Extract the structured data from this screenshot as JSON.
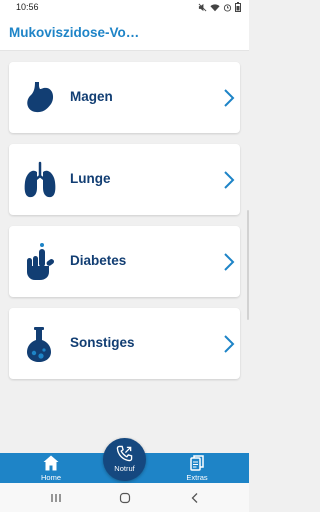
{
  "status_bar": {
    "time": "10:56"
  },
  "app_bar": {
    "title": "Mukoviszidose-Vo…"
  },
  "categories": [
    {
      "label": "Magen",
      "icon": "stomach-icon"
    },
    {
      "label": "Lunge",
      "icon": "lungs-icon"
    },
    {
      "label": "Diabetes",
      "icon": "finger-prick-icon"
    },
    {
      "label": "Sonstiges",
      "icon": "flask-icon"
    }
  ],
  "bottom_nav": {
    "home": {
      "label": "Home",
      "icon": "home-icon"
    },
    "notruf": {
      "label": "Notruf",
      "icon": "emergency-call-icon"
    },
    "extras": {
      "label": "Extras",
      "icon": "documents-icon"
    }
  },
  "colors": {
    "accent": "#1e84c7",
    "dark_blue": "#123e73",
    "fab": "#15487f",
    "background": "#f0f0f0"
  }
}
